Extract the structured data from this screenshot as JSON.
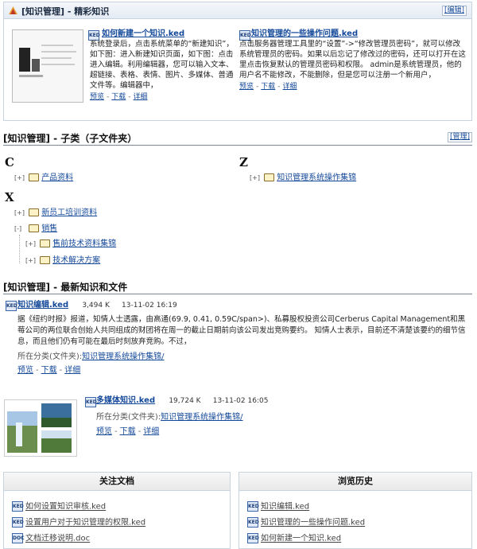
{
  "featured": {
    "title": "[知识管理] - 精彩知识",
    "edit_label": "[编辑]",
    "items": [
      {
        "title": "如何新建一个知识.ked",
        "desc": "系统登录后，点击系统菜单的“新建知识”，如下图：进入新建知识页面，如下图：点击进入编辑。利用编辑器，您可以输入文本、超链接、表格、表情、图片、多媒体、普通文件等。编辑器中，",
        "actions": [
          "预览",
          "下载",
          "详细"
        ]
      },
      {
        "title": "知识管理的一些操作问题.ked",
        "desc": "点击服务器管理工具里的“设置”->“修改管理员密码”，就可以修改系统管理员的密码。如果以后忘记了修改过的密码，还可以打开在这里点击恢复默认的管理员密码和权限。 admin是系统管理员，他的用户名不能修改，不能删除，但是您可以注册一个新用户，",
        "actions": [
          "预览",
          "下载",
          "详细"
        ]
      }
    ]
  },
  "subcat": {
    "title": "[知识管理] - 子类（子文件夹）",
    "manage_label": "[管理]",
    "groups": [
      {
        "letter": "C",
        "items": [
          {
            "toggle": "[+]",
            "label": "产品资料"
          }
        ]
      },
      {
        "letter": "Z",
        "items": [
          {
            "toggle": "[+]",
            "label": "知识管理系统操作集锦"
          }
        ]
      },
      {
        "letter": "X",
        "items": [
          {
            "toggle": "[+]",
            "label": "新员工培训资料"
          },
          {
            "toggle": "[-]",
            "label": "销售"
          },
          {
            "toggle": "[+]",
            "label": "售前技术资料集锦"
          },
          {
            "toggle": "[+]",
            "label": "技术解决方案"
          }
        ]
      }
    ]
  },
  "latest": {
    "title": "[知识管理] - 最新知识和文件",
    "entries": [
      {
        "title": "知识编辑.ked",
        "size": "3,494 K",
        "date": "13-11-02 16:19",
        "excerpt": "据《纽约时报》报道，知情人士透露，由高通(69.9, 0.41, 0.59C/span>)、私募股权投资公司Cerberus Capital Management和黑莓公司的两位联合创始人共同组成的财团将在周一的截止日期前向该公司发出竞购要约。        知情人士表示，目前还不清楚该要约的细节信息，而且他们仍有可能在最后时刻放弃竞购。不过，",
        "category_label": "所在分类(文件夹):",
        "category": "知识管理系统操作集锦/",
        "actions": [
          "预览",
          "下载",
          "详细"
        ]
      },
      {
        "title": "多媒体知识.ked",
        "size": "19,724 K",
        "date": "13-11-02 16:05",
        "category_label": "所在分类(文件夹):",
        "category": "知识管理系统操作集锦/",
        "actions": [
          "预览",
          "下载",
          "详细"
        ]
      }
    ]
  },
  "watched": {
    "title": "关注文档",
    "items": [
      "如何设置知识审核.ked",
      "设置用户对于知识管理的权限.ked",
      "文档迁移说明.doc"
    ]
  },
  "history": {
    "title": "浏览历史",
    "items": [
      "知识编辑.ked",
      "知识管理的一些操作问题.ked",
      "如何新建一个知识.ked"
    ]
  },
  "icons": {
    "doc_icon": "ked-document-icon",
    "folder_icon": "folder-icon",
    "section_icon": "knowledge-icon"
  },
  "colors": {
    "link": "#14499a",
    "border": "#c8d3e0"
  }
}
